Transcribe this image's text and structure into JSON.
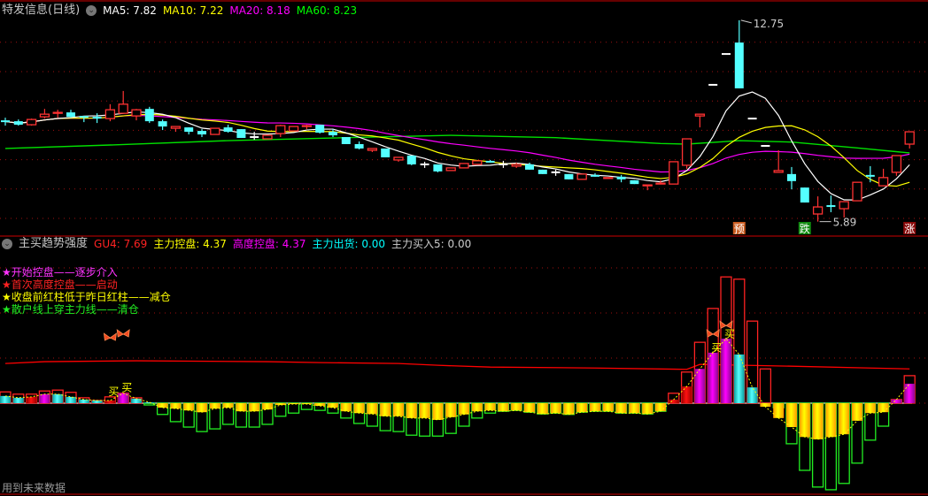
{
  "main_header": {
    "title": "特发信息(日线)",
    "ma5": "MA5: 7.82",
    "ma10": "MA10: 7.22",
    "ma20": "MA20: 8.18",
    "ma60": "MA60: 8.23"
  },
  "sub_header": {
    "title": "主买趋势强度",
    "gu4": "GU4: 7.69",
    "zlkp": "主力控盘: 4.37",
    "gdkp": "高度控盘: 4.37",
    "zlch": "主力出货: 0.00",
    "zlmr": "主力买入5: 0.00"
  },
  "legend": [
    {
      "star": "★",
      "text": "开始控盘——逐步介入",
      "color": "#ff30ff"
    },
    {
      "star": "★",
      "text": "首次高度控盘——启动",
      "color": "#ff2020"
    },
    {
      "star": "★",
      "text": "收盘前红柱低于昨日红柱——减仓",
      "color": "#ffff00"
    },
    {
      "star": "★",
      "text": "散户线上穿主力线——清仓",
      "color": "#20e020"
    }
  ],
  "annotations": {
    "high_label": "12.75",
    "low_label": "5.89",
    "tag_yu": "预",
    "tag_die": "跌",
    "tag_zhang": "涨",
    "buy": "买"
  },
  "footer": "用到未来数据",
  "colors": {
    "up": "#ff3232",
    "down": "#54ffff",
    "flat": "#ffffff",
    "ma5": "#ffffff",
    "ma10": "#ffff00",
    "ma20": "#ff00ff",
    "ma60": "#00e000",
    "grid": "#a01010"
  },
  "chart_data": {
    "type": "candlestick",
    "price_grid": [
      6,
      7,
      8,
      9,
      10,
      11,
      12
    ],
    "candles_ochl_note": "each candle = [open, close, high, low]",
    "candles": [
      [
        9.31,
        9.3,
        9.43,
        9.16
      ],
      [
        9.31,
        9.19,
        9.37,
        9.16
      ],
      [
        9.19,
        9.37,
        9.4,
        9.16
      ],
      [
        9.46,
        9.55,
        9.73,
        9.4
      ],
      [
        9.58,
        9.61,
        9.7,
        9.43
      ],
      [
        9.61,
        9.46,
        9.7,
        9.43
      ],
      [
        9.49,
        9.43,
        9.49,
        9.28
      ],
      [
        9.43,
        9.42,
        9.58,
        9.25
      ],
      [
        9.4,
        9.7,
        9.89,
        9.31
      ],
      [
        9.58,
        9.89,
        10.34,
        9.58
      ],
      [
        9.49,
        9.7,
        9.73,
        9.34
      ],
      [
        9.73,
        9.31,
        9.8,
        9.25
      ],
      [
        9.31,
        9.13,
        9.37,
        9.01
      ],
      [
        9.07,
        9.13,
        9.13,
        8.95
      ],
      [
        9.1,
        8.95,
        9.1,
        8.86
      ],
      [
        8.98,
        8.86,
        9.04,
        8.77
      ],
      [
        8.86,
        9.07,
        9.07,
        8.86
      ],
      [
        9.1,
        8.95,
        9.19,
        8.92
      ],
      [
        9.04,
        8.74,
        9.04,
        8.74
      ],
      [
        8.77,
        8.77,
        8.95,
        8.68
      ],
      [
        8.71,
        8.83,
        8.83,
        8.71
      ],
      [
        8.89,
        9.16,
        9.19,
        8.77
      ],
      [
        8.98,
        9.13,
        9.13,
        8.98
      ],
      [
        9.13,
        9.16,
        9.19,
        9.04
      ],
      [
        9.19,
        8.92,
        9.19,
        8.89
      ],
      [
        8.95,
        8.83,
        9.04,
        8.77
      ],
      [
        8.77,
        8.53,
        8.77,
        8.53
      ],
      [
        8.53,
        8.38,
        8.62,
        8.35
      ],
      [
        8.32,
        8.38,
        8.38,
        8.26
      ],
      [
        8.38,
        8.08,
        8.38,
        8.08
      ],
      [
        7.99,
        8.08,
        8.08,
        7.93
      ],
      [
        8.14,
        7.84,
        8.14,
        7.81
      ],
      [
        7.84,
        7.84,
        7.93,
        7.72
      ],
      [
        7.84,
        7.6,
        7.84,
        7.57
      ],
      [
        7.63,
        7.72,
        7.72,
        7.63
      ],
      [
        7.72,
        7.87,
        7.87,
        7.72
      ],
      [
        7.84,
        7.96,
        7.96,
        7.84
      ],
      [
        7.96,
        7.9,
        7.99,
        7.9
      ],
      [
        7.84,
        7.84,
        7.96,
        7.72
      ],
      [
        7.78,
        7.84,
        7.9,
        7.72
      ],
      [
        7.84,
        7.66,
        7.9,
        7.66
      ],
      [
        7.66,
        7.51,
        7.66,
        7.51
      ],
      [
        7.57,
        7.57,
        7.66,
        7.45
      ],
      [
        7.51,
        7.33,
        7.51,
        7.33
      ],
      [
        7.33,
        7.51,
        7.51,
        7.33
      ],
      [
        7.48,
        7.42,
        7.54,
        7.42
      ],
      [
        7.36,
        7.39,
        7.39,
        7.36
      ],
      [
        7.42,
        7.33,
        7.48,
        7.23
      ],
      [
        7.3,
        7.17,
        7.3,
        7.17
      ],
      [
        7.11,
        7.14,
        7.14,
        6.96
      ],
      [
        7.17,
        7.2,
        7.3,
        7.17
      ],
      [
        7.17,
        7.93,
        7.93,
        7.17
      ],
      [
        7.81,
        8.71,
        8.71,
        7.69
      ],
      [
        9.49,
        9.55,
        9.55,
        9.1
      ],
      [
        10.55,
        10.55,
        10.55,
        10.55
      ],
      [
        11.6,
        11.6,
        11.6,
        11.6
      ],
      [
        11.99,
        10.43,
        12.75,
        10.43
      ],
      [
        9.4,
        9.4,
        9.4,
        9.4
      ],
      [
        8.47,
        8.47,
        8.47,
        8.47
      ],
      [
        7.57,
        7.63,
        8.32,
        7.57
      ],
      [
        7.51,
        7.27,
        7.75,
        6.99
      ],
      [
        7.05,
        6.54,
        7.05,
        6.54
      ],
      [
        6.15,
        6.39,
        6.75,
        5.89
      ],
      [
        6.45,
        6.39,
        6.78,
        6.21
      ],
      [
        6.33,
        6.57,
        6.57,
        6.03
      ],
      [
        6.6,
        7.23,
        7.23,
        6.6
      ],
      [
        7.45,
        7.42,
        7.78,
        7.23
      ],
      [
        7.11,
        7.39,
        7.69,
        7.11
      ],
      [
        7.57,
        8.14,
        8.14,
        7.45
      ],
      [
        8.53,
        8.95,
        8.95,
        8.38
      ]
    ],
    "ma60_points": [
      [
        0,
        8.38
      ],
      [
        8,
        8.5
      ],
      [
        17,
        8.65
      ],
      [
        25,
        8.74
      ],
      [
        34,
        8.83
      ],
      [
        42,
        8.75
      ],
      [
        50,
        8.55
      ],
      [
        52,
        8.53
      ],
      [
        56,
        8.65
      ],
      [
        60,
        8.6
      ],
      [
        65,
        8.4
      ],
      [
        69,
        8.23
      ]
    ],
    "high_index": 56,
    "low_index": 62,
    "tags": [
      {
        "index": 56,
        "key": "tag_yu",
        "bg": "#c85a1e"
      },
      {
        "index": 61,
        "key": "tag_die",
        "bg": "#108a10"
      },
      {
        "index": 69,
        "key": "tag_zhang",
        "bg": "#8a0a0a"
      }
    ],
    "indicator": {
      "grid": [
        0,
        10,
        20,
        30
      ],
      "bars_note": "each = [outline_value, fill_value, fill_kind c=cyan r=red m=magenta y=yellow]",
      "bars": [
        [
          2.5,
          1.6,
          "c"
        ],
        [
          2.0,
          1.2,
          "c"
        ],
        [
          2.0,
          1.4,
          "r"
        ],
        [
          2.7,
          2.0,
          "m"
        ],
        [
          2.9,
          2.0,
          "c"
        ],
        [
          2.4,
          1.4,
          "c"
        ],
        [
          1.2,
          0.8,
          "c"
        ],
        [
          0.6,
          0.6,
          "c"
        ],
        [
          1.4,
          0.6,
          "r"
        ],
        [
          2.2,
          2.2,
          "m"
        ],
        [
          1.2,
          1.0,
          "c"
        ],
        [
          -0.4,
          0.2,
          "c"
        ],
        [
          -2.5,
          -1.0,
          "y"
        ],
        [
          -4.1,
          -1.2,
          "y"
        ],
        [
          -5.3,
          -1.6,
          "y"
        ],
        [
          -6.3,
          -2.0,
          "y"
        ],
        [
          -5.7,
          -1.2,
          "y"
        ],
        [
          -4.7,
          -1.0,
          "y"
        ],
        [
          -5.3,
          -1.8,
          "y"
        ],
        [
          -5.3,
          -1.8,
          "y"
        ],
        [
          -4.7,
          -1.4,
          "y"
        ],
        [
          -2.9,
          -0.4,
          "y"
        ],
        [
          -2.2,
          -0.2,
          "y"
        ],
        [
          -1.4,
          -0.2,
          "y"
        ],
        [
          -1.6,
          -0.6,
          "y"
        ],
        [
          -2.2,
          -1.0,
          "y"
        ],
        [
          -3.3,
          -1.8,
          "y"
        ],
        [
          -4.5,
          -2.2,
          "y"
        ],
        [
          -5.1,
          -2.4,
          "y"
        ],
        [
          -6.1,
          -2.9,
          "y"
        ],
        [
          -6.3,
          -2.9,
          "y"
        ],
        [
          -7.1,
          -3.3,
          "y"
        ],
        [
          -7.3,
          -3.3,
          "y"
        ],
        [
          -7.3,
          -3.7,
          "y"
        ],
        [
          -6.7,
          -3.1,
          "y"
        ],
        [
          -5.1,
          -2.5,
          "y"
        ],
        [
          -3.3,
          -1.8,
          "y"
        ],
        [
          -2.2,
          -1.6,
          "y"
        ],
        [
          -1.8,
          -1.8,
          "y"
        ],
        [
          -1.6,
          -1.6,
          "y"
        ],
        [
          -2.0,
          -2.0,
          "y"
        ],
        [
          -2.4,
          -2.4,
          "y"
        ],
        [
          -2.2,
          -2.2,
          "y"
        ],
        [
          -2.5,
          -2.5,
          "y"
        ],
        [
          -2.0,
          -2.0,
          "y"
        ],
        [
          -1.8,
          -1.8,
          "y"
        ],
        [
          -1.8,
          -1.8,
          "y"
        ],
        [
          -2.2,
          -2.2,
          "y"
        ],
        [
          -2.2,
          -2.2,
          "y"
        ],
        [
          -2.4,
          -2.4,
          "y"
        ],
        [
          -1.8,
          -1.8,
          "y"
        ],
        [
          2.2,
          0.8,
          "r"
        ],
        [
          6.9,
          3.7,
          "r"
        ],
        [
          13.5,
          7.6,
          "m"
        ],
        [
          21,
          11.2,
          "m"
        ],
        [
          28,
          14.3,
          "m"
        ],
        [
          27.5,
          10.8,
          "c"
        ],
        [
          18.2,
          3.5,
          "c"
        ],
        [
          7.6,
          -0.8,
          "y"
        ],
        [
          -1.0,
          -3.3,
          "y"
        ],
        [
          -9.0,
          -5.3,
          "y"
        ],
        [
          -14.9,
          -7.5,
          "y"
        ],
        [
          -18.6,
          -8.0,
          "y"
        ],
        [
          -19.2,
          -7.5,
          "y"
        ],
        [
          -17.8,
          -6.9,
          "y"
        ],
        [
          -13.3,
          -3.9,
          "y"
        ],
        [
          -8.2,
          -2.2,
          "y"
        ],
        [
          -5.1,
          -2.0,
          "y"
        ],
        [
          0.8,
          0.8,
          "m"
        ],
        [
          6.1,
          4.3,
          "m"
        ]
      ],
      "redline_points": [
        [
          0,
          8.8
        ],
        [
          3,
          9.2
        ],
        [
          10,
          9.4
        ],
        [
          20,
          9.2
        ],
        [
          24,
          9.0
        ],
        [
          30,
          8.8
        ],
        [
          33,
          8.4
        ],
        [
          37,
          8.0
        ],
        [
          45,
          7.8
        ],
        [
          52,
          7.5
        ],
        [
          53,
          8.6
        ],
        [
          60,
          8.2
        ],
        [
          66,
          7.8
        ],
        [
          69,
          7.6
        ]
      ],
      "buy_signals": [
        {
          "index": 8,
          "value": 1.8
        },
        {
          "index": 9,
          "value": 2.6
        },
        {
          "index": 54,
          "value": 11.5
        },
        {
          "index": 55,
          "value": 14.5
        }
      ],
      "butterflies": [
        {
          "index": 8,
          "value": 14.5
        },
        {
          "index": 9,
          "value": 15.3
        },
        {
          "index": 54,
          "value": 15.3
        },
        {
          "index": 55,
          "value": 17.2
        }
      ]
    }
  }
}
